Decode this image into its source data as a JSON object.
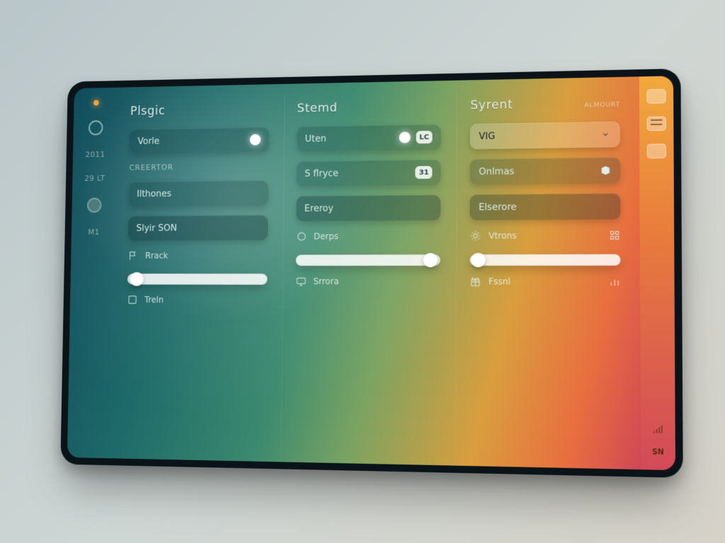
{
  "rail": {
    "label1": "2011",
    "label2": "29 LT",
    "label3": "M1"
  },
  "columns": [
    {
      "title": "Plsgic",
      "items": [
        {
          "label": "Vorle",
          "kind": "toggle"
        },
        {
          "label": "Creertor",
          "kind": "muted"
        },
        {
          "label": "Ilthones",
          "kind": "pill"
        },
        {
          "label": "Slyir SON",
          "kind": "input"
        }
      ],
      "footer1": {
        "icon": "flag",
        "label": "Rrack"
      },
      "slider": {
        "pos": 0.06
      },
      "footer2": {
        "icon": "square",
        "label": "Treln"
      }
    },
    {
      "title": "Stemd",
      "items": [
        {
          "label": "Uten",
          "kind": "toggle",
          "badge": "LC"
        },
        {
          "label": "S flryce",
          "kind": "pill",
          "badge": "31"
        },
        {
          "label": "Ereroy",
          "kind": "input"
        }
      ],
      "footer1": {
        "icon": "circle",
        "label": "Derps"
      },
      "slider": {
        "pos": 0.88
      },
      "footer2": {
        "icon": "monitor",
        "label": "Srrora"
      }
    },
    {
      "title": "Syrent",
      "meta": "ALMOURT",
      "items": [
        {
          "label": "VIG",
          "kind": "light"
        },
        {
          "label": "Onlmas",
          "kind": "pill"
        },
        {
          "label": "Elserore",
          "kind": "input"
        }
      ],
      "footer1": {
        "icon": "sun",
        "label": "Vtrons"
      },
      "slider": {
        "pos": 0.02
      },
      "footer2": {
        "icon": "gift",
        "label": "Fssnl"
      }
    }
  ],
  "strip": {
    "tag": "SN"
  }
}
